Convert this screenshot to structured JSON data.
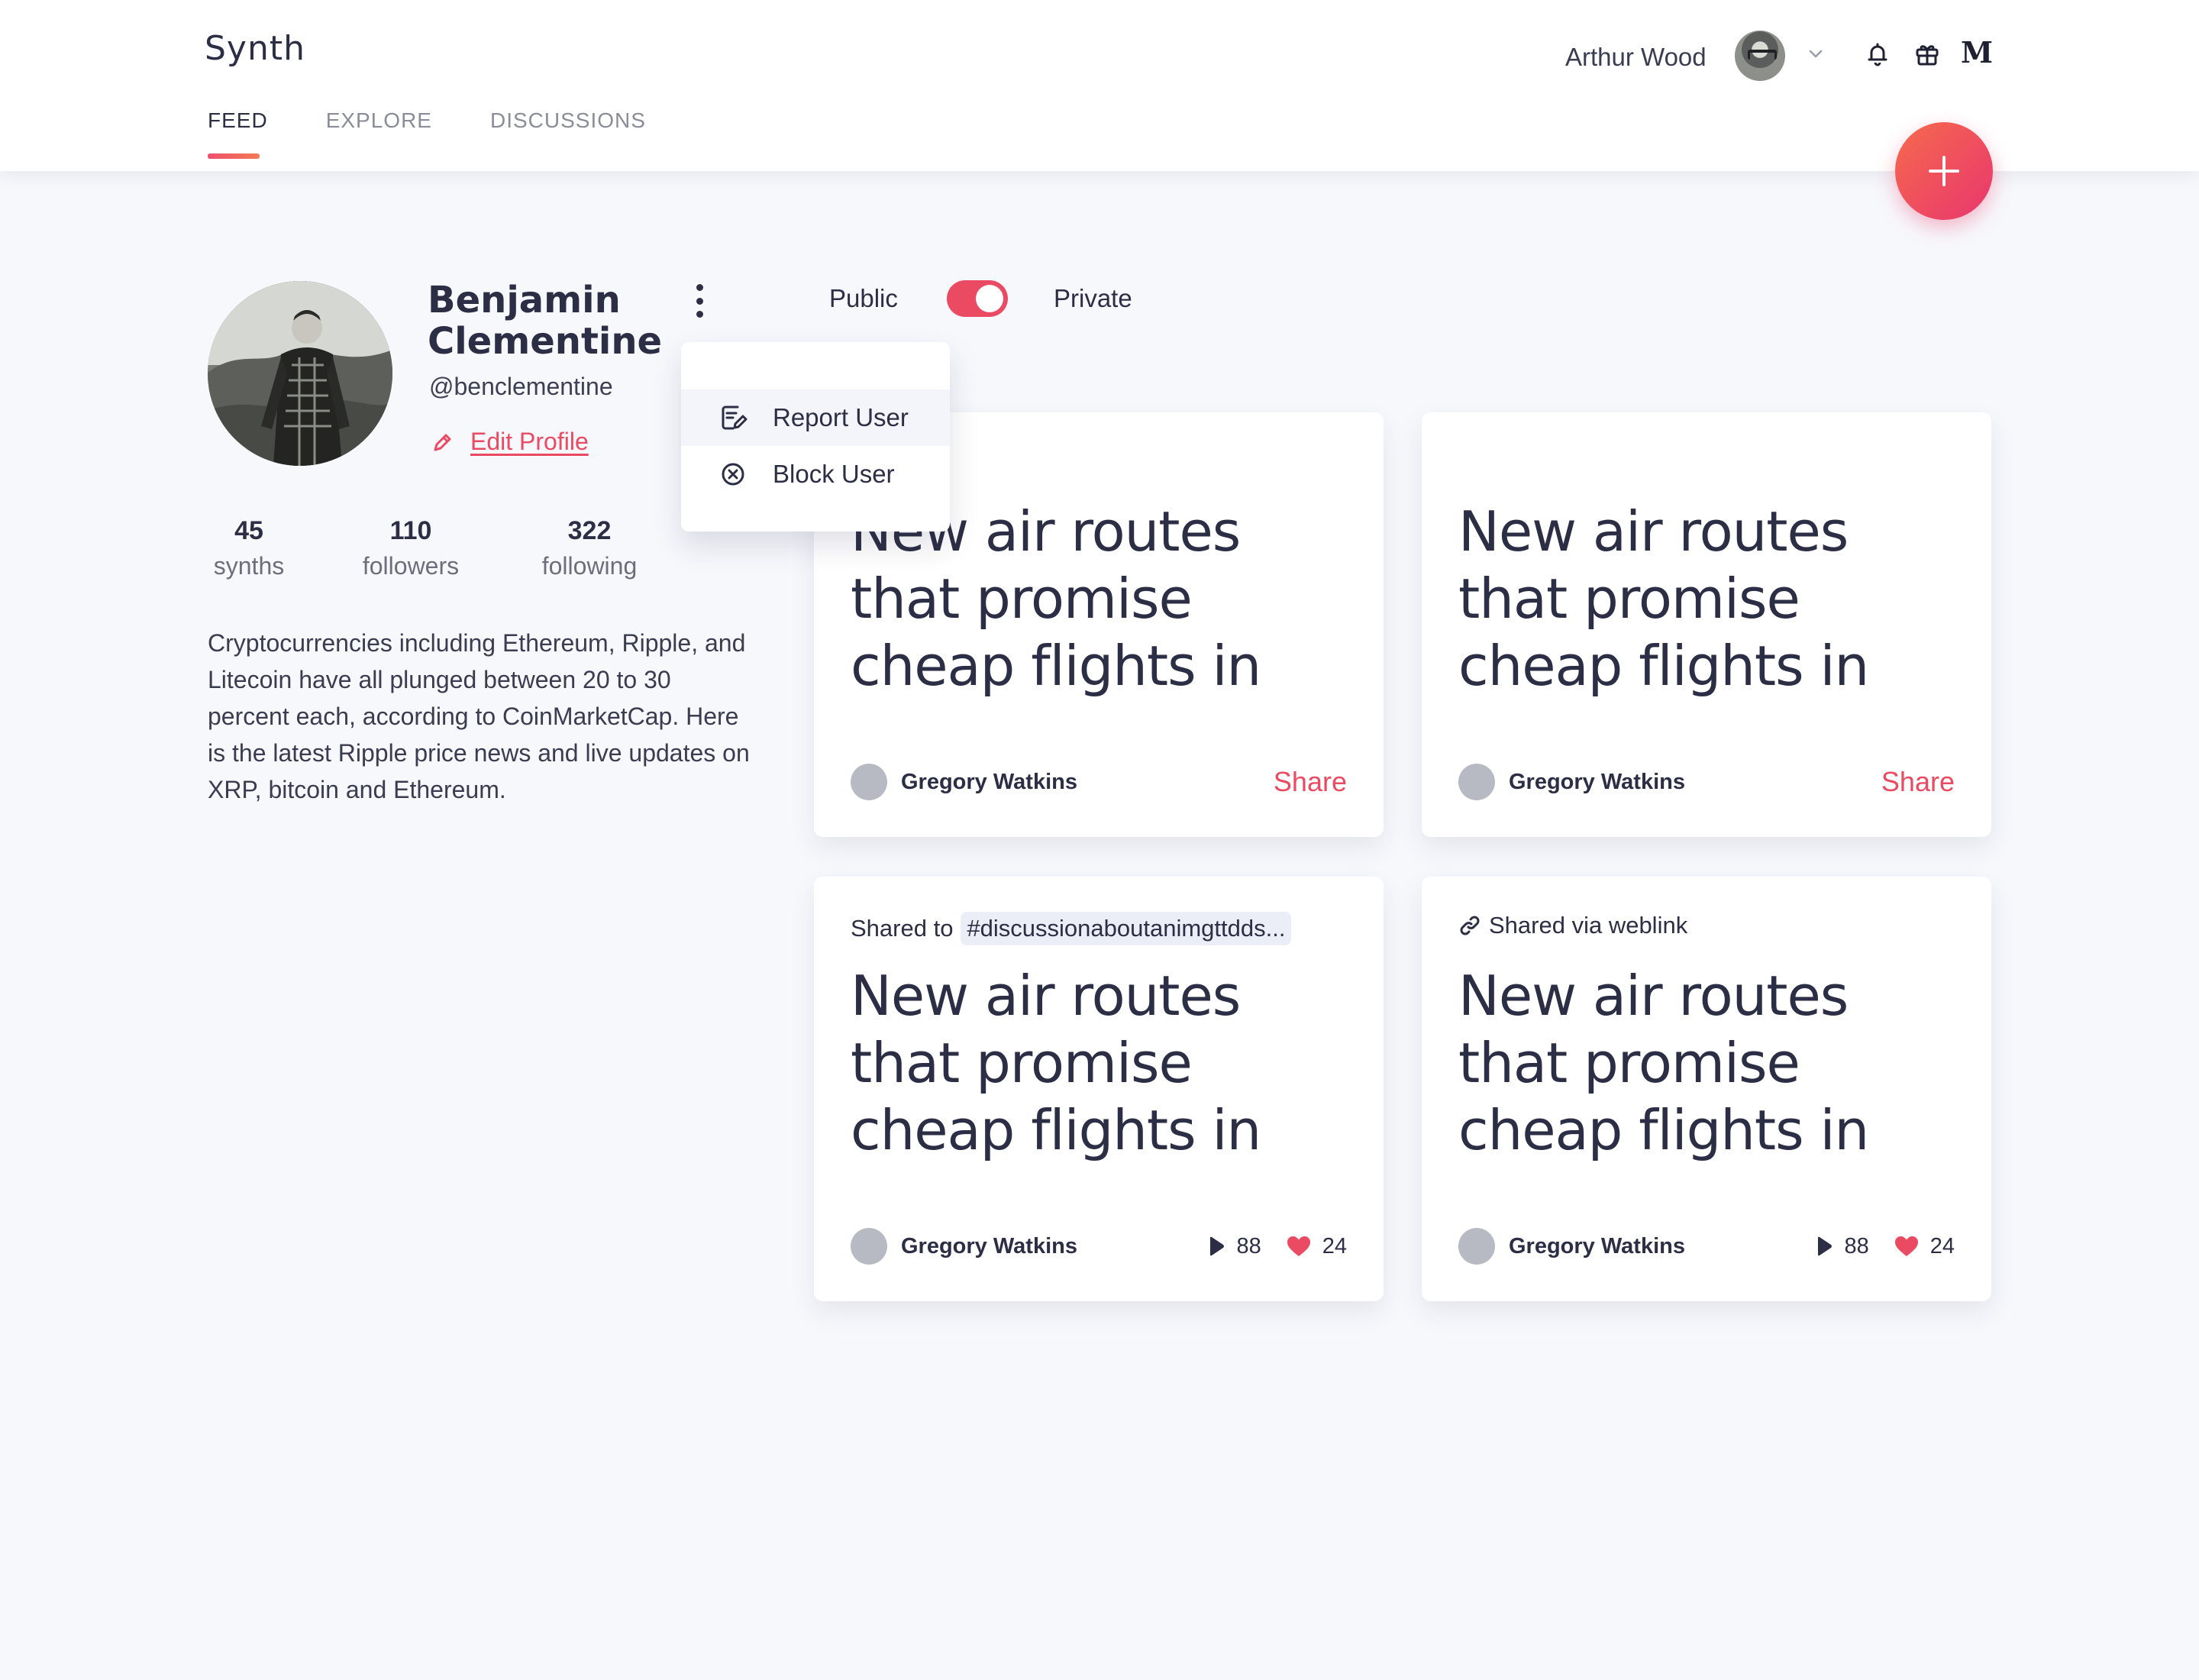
{
  "app": {
    "logo": "Synth"
  },
  "nav": {
    "tabs": [
      {
        "label": "FEED"
      },
      {
        "label": "EXPLORE"
      },
      {
        "label": "DISCUSSIONS"
      }
    ]
  },
  "header": {
    "user_name": "Arthur Wood",
    "icons": [
      "bell-icon",
      "gift-icon",
      "medium-icon"
    ],
    "m_glyph": "M"
  },
  "profile": {
    "name": "Benjamin Clementine",
    "handle": "@benclementine",
    "edit_label": "Edit Profile",
    "stats": [
      {
        "value": "45",
        "label": "synths"
      },
      {
        "value": "110",
        "label": "followers"
      },
      {
        "value": "322",
        "label": "following"
      }
    ],
    "bio": "Cryptocurrencies including Ethereum, Ripple, and Litecoin have all plunged between 20 to 30 percent each, according to CoinMarketCap. Here is the latest Ripple price news and live updates on XRP, bitcoin and Ethereum."
  },
  "visibility": {
    "public_label": "Public",
    "private_label": "Private",
    "private_on": true
  },
  "menu": {
    "items": [
      {
        "label": "Report User",
        "icon": "report-icon"
      },
      {
        "label": "Block User",
        "icon": "block-icon"
      }
    ]
  },
  "cards": [
    {
      "title": "New air routes that promise cheap flights in",
      "author": "Gregory Watkins",
      "action": "Share"
    },
    {
      "title": "New air routes that promise cheap flights in",
      "author": "Gregory Watkins",
      "action": "Share"
    },
    {
      "shared_prefix": "Shared to",
      "tag": "#discussionaboutanimgttdds...",
      "title": "New air routes that promise cheap flights in",
      "author": "Gregory Watkins",
      "plays": "88",
      "likes": "24"
    },
    {
      "shared_label": "Shared via weblink",
      "title": "New air routes that promise cheap flights in",
      "author": "Gregory Watkins",
      "plays": "88",
      "likes": "24"
    }
  ],
  "colors": {
    "accent": "#ea4a62",
    "text": "#2c2e45",
    "background": "#f7f8fc"
  }
}
